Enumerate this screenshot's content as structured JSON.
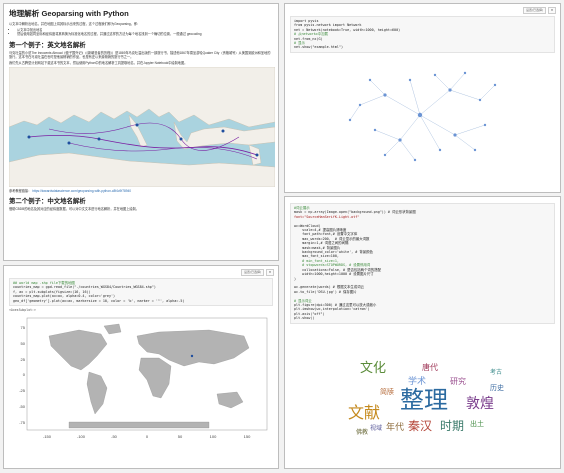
{
  "panel1": {
    "title": "地理解析 Geoparsing with Python",
    "intro": "以文本中解析出地名，并在地图上将其标示出来的过程，这个过程我们称为Geoparsing，即：",
    "bullets": [
      "从文本中找出地名",
      "然后使用如同坐标和经纬度将其转换为标准化地名的过程，并通过这样的方法为每个地名找到一个确切的位置，一般通过 geocoding"
    ],
    "h2_1": "第一个例子：英文地名解析",
    "para1": "马克吐温的小说The Innocents Abroad《傻子国外记》（《新朝圣者的历程》）是1869年马克吐温出版的一部旅行书，描述他1867年乘坐游轮Quaker City（贵格城号）从美国到欧洲和圣地的旅行。这本书在马克吐温在世时是他最畅销的作品，也是有史以来最畅销的旅行书之一。",
    "para2": "我们先从古腾堡计划网站下载这本书的文本，然后使用Python中的地名解析工具提取地名，并在Jupyter Notebook中绘制地图。",
    "ref_label": "参考教程链接：",
    "ref_link": "https://towardsdatascience.com/geoparsing-with-python-c8f4c9f78940",
    "h2_2": "第二个例子：中文地名解析",
    "para3": "借助CBDB的地名及其对应的经纬度数据，可以对中文文本进行地名解析，并在地图上绘制。"
  },
  "panel2": {
    "toolbar_select": "设置(已选择)",
    "code": [
      "import pyvis",
      "from pyvis.network import Network",
      "net = Network(notebook=True, width=1000, height=600)",
      "# 从networkx中加载",
      "net.from_nx(G)",
      "# 显示",
      "net.show(\"example.html\")"
    ]
  },
  "panel3": {
    "toolbar_select": "设置(已选择)",
    "code": [
      "## world map .shp file下载的地图",
      "countries_map = gpd.read_file(\"./countries_WGS84/Countries_WGS84.shp\")",
      "f, ax = plt.subplots(figsize=(16, 16))",
      "countries_map.plot(ax=ax, alpha=0.4, color='grey')",
      "geo_df['geometry'].plot(ax=ax, markersize = 10, color = 'b', marker = '^', alpha=.5)"
    ],
    "output": "<AxesSubplot:>",
    "x_ticks": [
      "-150",
      "-100",
      "-50",
      "0",
      "50",
      "100",
      "150"
    ],
    "y_ticks": [
      "75",
      "50",
      "25",
      "0",
      "-25",
      "-50",
      "-75"
    ]
  },
  "panel4": {
    "code": [
      "#词云展示",
      "mask = np.array(Image.open(\"background.png\")) # 词云形状背景图",
      "font=\"SourceHanSerifK-Light.otf\"",
      "",
      "wc=WordCloud(",
      "    scale=4,# 提高图片清晰度",
      "    font_path=font,# 设置中文字体",
      "    max_words=200,  # 词云显示的最大词数",
      "    margin=1,# 词语之间的间隔",
      "    mask=mask,# 背景图片",
      "    background_color='white', # 背景颜色",
      "    max_font_size=100,",
      "    # min_font_size=1,",
      "    # stopwords=STOPWORDS, # 设置停用词",
      "    collocations=False, # 是否包括两个词的搭配",
      "    width=1000,height=1000 # 设置图片尺寸",
      ")",
      "",
      "wc.generate(words) # 根据文本生成词云",
      "wc.to_file('DSU.jpg') # 保存图片",
      "",
      "# 显示词云",
      "plt.figure(dpi=300) # 通过这里可以放大或缩小",
      "plt.imshow(wc,interpolation='catrom')",
      "plt.axis(\"off\")",
      "plt.show()"
    ],
    "words": [
      "文化",
      "整理",
      "敦煌",
      "文献",
      "秦汉",
      "时期",
      "年代",
      "学术",
      "研究",
      "出土",
      "简牍",
      "历史",
      "唐代",
      "佛教",
      "考古",
      "视域"
    ]
  }
}
